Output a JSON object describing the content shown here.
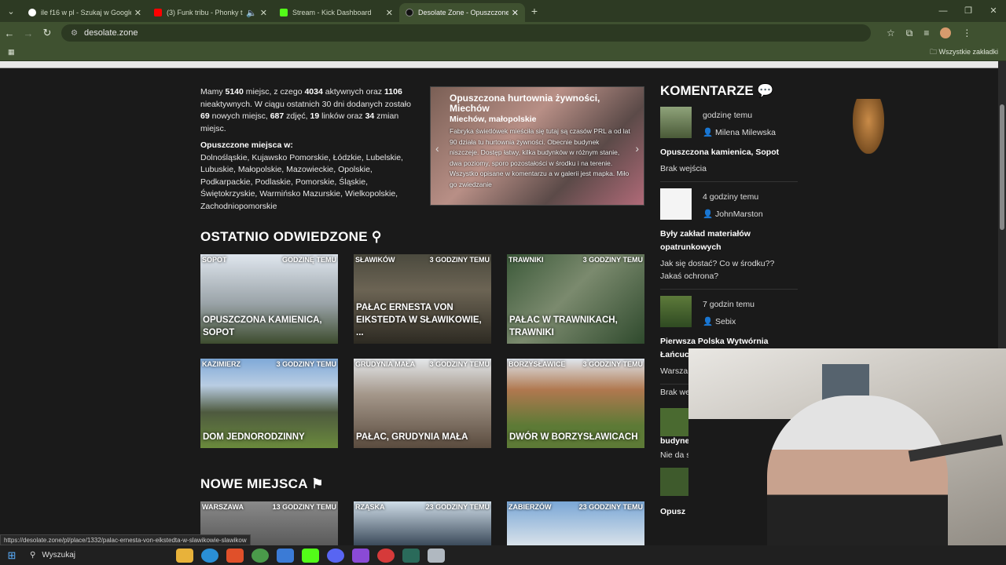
{
  "browser": {
    "tabs": [
      {
        "title": "ile f16 w pl - Szukaj w Google",
        "color": "#ffffff"
      },
      {
        "title": "(3) Funk tribu - Phonky trib",
        "color": "#ff0000"
      },
      {
        "title": "Stream - Kick Dashboard",
        "color": "#53fc18"
      },
      {
        "title": "Desolate Zone - Opuszczone m",
        "color": "#222222"
      }
    ],
    "url": "desolate.zone",
    "bookmarks_label": "Wszystkie zakładki"
  },
  "intro": {
    "p1": "Mamy ",
    "n_places": "5140",
    "p2": " miejsc, z czego ",
    "n_active": "4034",
    "p3": " aktywnych oraz ",
    "n_inactive": "1106",
    "p4": " nieaktywnych. W ciągu ostatnich 30 dni dodanych zostało ",
    "n_new": "69",
    "p5": " nowych miejsc, ",
    "n_photos": "687",
    "p6": " zdjęć, ",
    "n_links": "19",
    "p7": " linków oraz ",
    "n_changes": "34",
    "p8": " zmian miejsc.",
    "regions_title": "Opuszczone miejsca w:",
    "regions": "Dolnośląskie, Kujawsko Pomorskie, Łódzkie, Lubelskie, Lubuskie, Małopolskie, Mazowieckie, Opolskie, Podkarpackie, Podlaskie, Pomorskie, Śląskie, Świętokrzyskie, Warmińsko Mazurskie, Wielkopolskie, Zachodniopomorskie"
  },
  "slider": {
    "title": "Opuszczona hurtownia żywności, Miechów",
    "subtitle": "Miechów, małopolskie",
    "desc": "Fabryka świetlówek mieściła się tutaj są czasów PRL a od lat 90 działa tu hurtownia żywności. Obecnie budynek niszczeje. Dostęp łatwy, kilka budynków w różnym stanie, dwa poziomy, sporo pozostałości w środku i na terenie. Wszystko opisane w komentarzu a w galerii jest mapka. Miło go zwiedzanie"
  },
  "recent": {
    "title": "OSTATNIO ODWIEDZONE",
    "cards": [
      {
        "loc": "SOPOT",
        "time": "GODZINĘ TEMU",
        "name": "OPUSZCZONA KAMIENICA, SOPOT"
      },
      {
        "loc": "SŁAWIKÓW",
        "time": "3 GODZINY TEMU",
        "name": "PAŁAC ERNESTA VON EIKSTEDTA W SŁAWIKOWIE, ..."
      },
      {
        "loc": "TRAWNIKI",
        "time": "3 GODZINY TEMU",
        "name": "PAŁAC W TRAWNIKACH, TRAWNIKI"
      },
      {
        "loc": "KAZIMIERZ",
        "time": "3 GODZINY TEMU",
        "name": "DOM JEDNORODZINNY"
      },
      {
        "loc": "GRUDYNIA MAŁA",
        "time": "3 GODZINY TEMU",
        "name": "PAŁAC, GRUDYNIA MAŁA"
      },
      {
        "loc": "BORZYSŁAWICE",
        "time": "3 GODZINY TEMU",
        "name": "DWÓR W BORZYSŁAWICACH"
      }
    ]
  },
  "newplaces": {
    "title": "NOWE MIEJSCA",
    "cards": [
      {
        "loc": "WARSZAWA",
        "time": "13 GODZINY TEMU"
      },
      {
        "loc": "RZĄSKA",
        "time": "23 GODZINY TEMU"
      },
      {
        "loc": "ZABIERZÓW",
        "time": "23 GODZINY TEMU"
      }
    ]
  },
  "comments": {
    "title": "KOMENTARZE",
    "items": [
      {
        "time": "godzinę temu",
        "user": "Milena Milewska",
        "place": "Opuszczona kamienica, Sopot",
        "text": "Brak wejścia"
      },
      {
        "time": "4 godziny temu",
        "user": "JohnMarston",
        "place": "Były zakład materiałów opatrunkowych",
        "text": "Jak się dostać? Co w środku?? Jakaś ochrona?"
      },
      {
        "time": "7 godzin temu",
        "user": "Sebix",
        "place": "Pierwsza Polska Wytwórnia Łańcuc",
        "text": "Warsza"
      }
    ],
    "partial": [
      "Brak we",
      "budyne",
      "Nie da s",
      "Opusz"
    ]
  },
  "status_url": "https://desolate.zone/pl/place/1332/palac-ernesta-von-eikstedta-w-slawikowie-slawikow",
  "taskbar": {
    "search": "Wyszukaj"
  }
}
